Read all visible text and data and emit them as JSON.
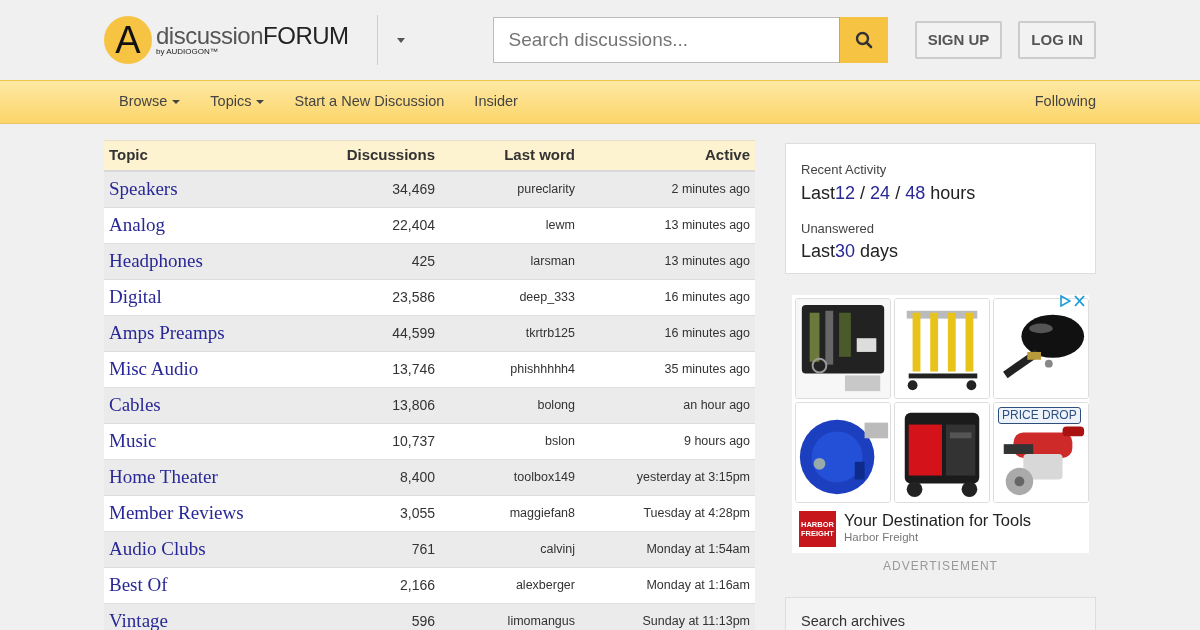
{
  "logo": {
    "letter": "A",
    "word": "discussion",
    "brand": "FORUM",
    "byline": "by AUDIOGON™"
  },
  "search": {
    "placeholder": "Search discussions..."
  },
  "account_buttons": [
    "SIGN UP",
    "LOG IN"
  ],
  "nav": {
    "items": [
      {
        "label": "Browse",
        "dropdown": true
      },
      {
        "label": "Topics",
        "dropdown": true
      },
      {
        "label": "Start a New Discussion",
        "dropdown": false
      },
      {
        "label": "Insider",
        "dropdown": false
      }
    ],
    "right": "Following"
  },
  "table": {
    "columns": [
      "Topic",
      "Discussions",
      "Last word",
      "Active"
    ],
    "rows": [
      {
        "topic": "Speakers",
        "discussions": "34,469",
        "last_word": "pureclarity",
        "active": "2 minutes ago"
      },
      {
        "topic": "Analog",
        "discussions": "22,404",
        "last_word": "lewm",
        "active": "13 minutes ago"
      },
      {
        "topic": "Headphones",
        "discussions": "425",
        "last_word": "larsman",
        "active": "13 minutes ago"
      },
      {
        "topic": "Digital",
        "discussions": "23,586",
        "last_word": "deep_333",
        "active": "16 minutes ago"
      },
      {
        "topic": "Amps Preamps",
        "discussions": "44,599",
        "last_word": "tkrtrb125",
        "active": "16 minutes ago"
      },
      {
        "topic": "Misc Audio",
        "discussions": "13,746",
        "last_word": "phishhhhh4",
        "active": "35 minutes ago"
      },
      {
        "topic": "Cables",
        "discussions": "13,806",
        "last_word": "bolong",
        "active": "an hour ago"
      },
      {
        "topic": "Music",
        "discussions": "10,737",
        "last_word": "bslon",
        "active": "9 hours ago"
      },
      {
        "topic": "Home Theater",
        "discussions": "8,400",
        "last_word": "toolbox149",
        "active": "yesterday at 3:15pm"
      },
      {
        "topic": "Member Reviews",
        "discussions": "3,055",
        "last_word": "maggiefan8",
        "active": "Tuesday at 4:28pm"
      },
      {
        "topic": "Audio Clubs",
        "discussions": "761",
        "last_word": "calvinj",
        "active": "Monday at 1:54am"
      },
      {
        "topic": "Best Of",
        "discussions": "2,166",
        "last_word": "alexberger",
        "active": "Monday at 1:16am"
      },
      {
        "topic": "Vintage",
        "discussions": "596",
        "last_word": "limomangus",
        "active": "Sunday at 11:13pm"
      }
    ]
  },
  "activity": [
    {
      "label": "Recent Activity",
      "prefix": "Last",
      "links": [
        "12",
        "24",
        "48"
      ],
      "separator": "/",
      "suffix": "hours"
    },
    {
      "label": "Unanswered",
      "prefix": "Last",
      "links": [
        "30"
      ],
      "suffix": "days"
    }
  ],
  "ad": {
    "tiles": [
      {
        "kind": "picture"
      },
      {
        "kind": "picture"
      },
      {
        "kind": "picture"
      },
      {
        "kind": "picture"
      },
      {
        "kind": "picture"
      },
      {
        "kind": "picture",
        "badge": "PRICE DROP"
      }
    ],
    "advertiser_logo": "HARBOR FREIGHT",
    "headline": "Your Destination for Tools",
    "advertiser": "Harbor Freight",
    "label": "ADVERTISEMENT"
  },
  "archives": {
    "title": "Search archives"
  }
}
